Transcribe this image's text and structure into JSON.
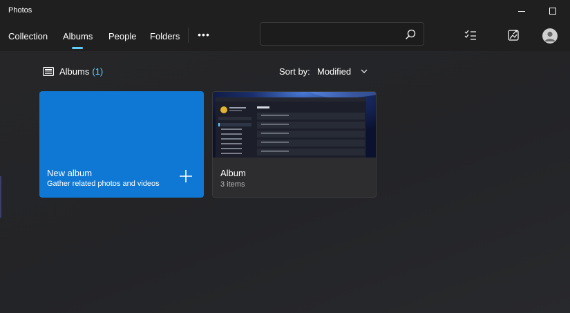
{
  "app": {
    "title": "Photos"
  },
  "nav": {
    "tabs": [
      {
        "label": "Collection",
        "selected": false
      },
      {
        "label": "Albums",
        "selected": true
      },
      {
        "label": "People",
        "selected": false
      },
      {
        "label": "Folders",
        "selected": false
      }
    ],
    "more_label": "•••"
  },
  "search": {
    "value": "",
    "placeholder": "",
    "icon": "search-icon"
  },
  "toolbar": {
    "icons": [
      "select-icon",
      "import-icon",
      "account-avatar"
    ]
  },
  "albums_header": {
    "label": "Albums",
    "count": "(1)",
    "icon": "albums-icon"
  },
  "sort": {
    "label": "Sort by:",
    "value": "Modified"
  },
  "cards": [
    {
      "title": "New album",
      "subtitle": "Gather related photos and videos",
      "icon": "plus-icon"
    },
    {
      "title": "Album",
      "subtitle": "3 items"
    }
  ],
  "colors": {
    "accent": "#60cdff",
    "new_album_card": "#0f78d4",
    "background": "#202020"
  }
}
